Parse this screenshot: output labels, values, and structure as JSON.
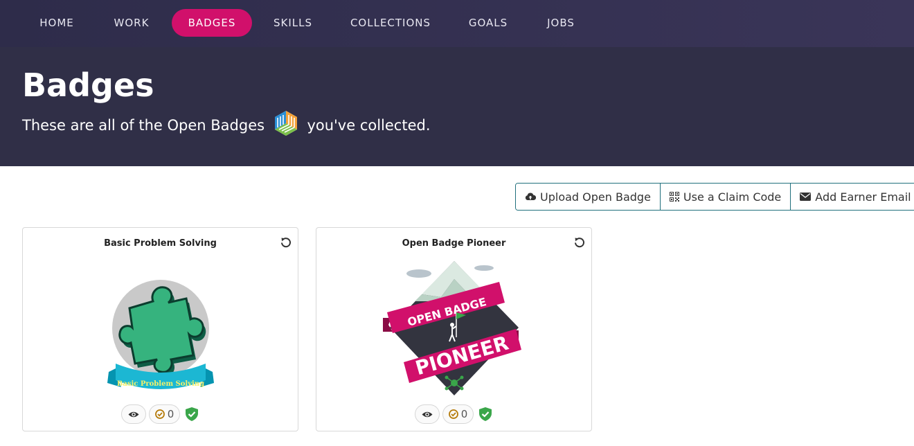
{
  "nav": {
    "items": [
      {
        "label": "HOME",
        "active": false
      },
      {
        "label": "WORK",
        "active": false
      },
      {
        "label": "BADGES",
        "active": true
      },
      {
        "label": "SKILLS",
        "active": false
      },
      {
        "label": "COLLECTIONS",
        "active": false
      },
      {
        "label": "GOALS",
        "active": false
      },
      {
        "label": "JOBS",
        "active": false
      }
    ]
  },
  "hero": {
    "title": "Badges",
    "subtitle_before": "These are all of the Open Badges",
    "subtitle_after": "you've collected.",
    "logo_icon": "open-badges-logo"
  },
  "actions": {
    "upload": {
      "label": "Upload Open Badge",
      "icon": "cloud-upload-icon"
    },
    "claim": {
      "label": "Use a Claim Code",
      "icon": "qr-code-icon"
    },
    "email": {
      "label": "Add Earner Email",
      "icon": "envelope-icon"
    }
  },
  "badges": [
    {
      "title": "Basic Problem Solving",
      "image_text": "Basic Problem Solving",
      "endorsements": "0",
      "verified": true
    },
    {
      "title": "Open Badge Pioneer",
      "image_text_top": "OPEN BADGE",
      "image_text_bottom": "PIONEER",
      "endorsements": "0",
      "verified": true
    }
  ],
  "colors": {
    "nav_bg": "#2e2c4a",
    "hero_bg": "#302f47",
    "accent": "#d1106b",
    "button_border": "#1f6f7c",
    "verified": "#3aa64a"
  }
}
